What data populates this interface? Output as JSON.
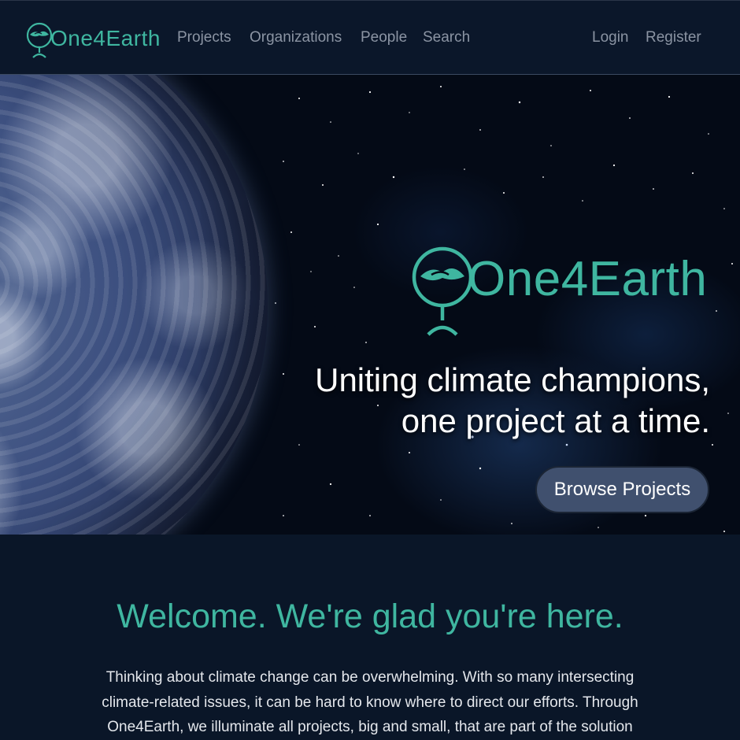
{
  "nav": {
    "brand": "One4Earth",
    "links": [
      "Projects",
      "Organizations",
      "People",
      "Search"
    ],
    "auth": [
      "Login",
      "Register"
    ]
  },
  "hero": {
    "logo_text": "One4Earth",
    "tagline_line1": "Uniting climate champions,",
    "tagline_line2": "one project at a time.",
    "cta_label": "Browse Projects"
  },
  "welcome": {
    "heading": "Welcome. We're glad you're here.",
    "body": "Thinking about climate change can be overwhelming. With so many intersecting climate-related issues, it can be hard to know where to direct our efforts. Through One4Earth, we illuminate all projects, big and small, that are part of the solution"
  },
  "colors": {
    "accent": "#3fb6a0",
    "background": "#0a1628",
    "nav_text": "#8b94a3",
    "button": "#40506e"
  },
  "icons": {
    "brand": "globe-hands-icon"
  }
}
